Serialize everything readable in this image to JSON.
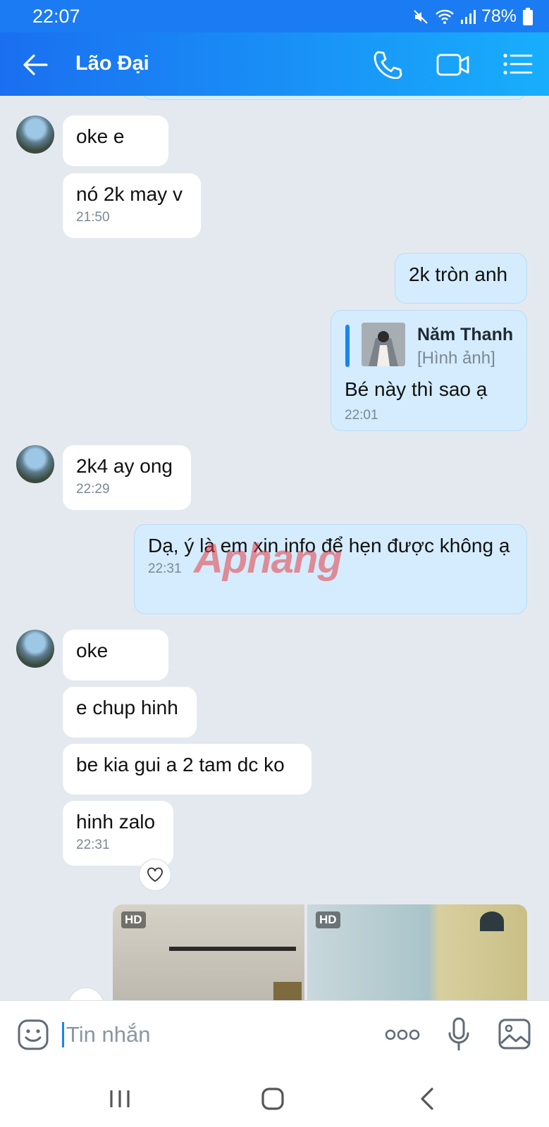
{
  "status_bar": {
    "time": "22:07",
    "battery": "78%"
  },
  "header": {
    "title": "Lão Đại"
  },
  "messages": [
    {
      "text": "oke e"
    },
    {
      "text": "nó 2k may v",
      "time": "21:50"
    },
    {
      "text": "2k tròn anh"
    },
    {
      "quote_name": "Năm Thanh",
      "quote_type": "[Hình ảnh]",
      "text": "Bé này thì sao ạ",
      "time": "22:01"
    },
    {
      "text": "2k4 ay ong",
      "time": "22:29"
    },
    {
      "text": "Dạ, ý là em xin info để hẹn được không ạ",
      "time": "22:31"
    },
    {
      "text": "oke"
    },
    {
      "text": "e chup hinh"
    },
    {
      "text": "be kia gui a 2 tam dc ko"
    },
    {
      "text": "hinh zalo",
      "time": "22:31"
    }
  ],
  "photos": [
    {
      "badge": "HD"
    },
    {
      "badge": "HD"
    }
  ],
  "watermark": "Aphang",
  "input": {
    "placeholder": "Tin nhắn"
  }
}
